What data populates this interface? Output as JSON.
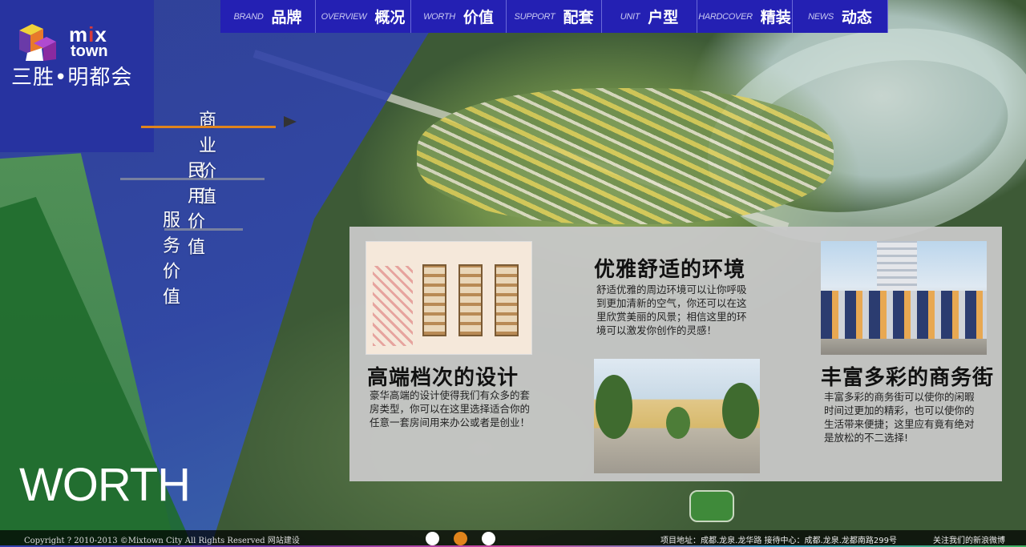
{
  "logo": {
    "brand_mix_left": "m",
    "brand_mix_i": "i",
    "brand_mix_right": "x",
    "brand_town": "town",
    "brand_cn": "三胜•明都会"
  },
  "colors": {
    "nav_bg": "#2420b3",
    "accent_orange": "#e0841c",
    "panel_bg": "#c8c8c8",
    "logo_block": "#2733a0"
  },
  "nav": [
    {
      "en": "BRAND",
      "zh": "品牌"
    },
    {
      "en": "OVERVIEW",
      "zh": "概况"
    },
    {
      "en": "WORTH",
      "zh": "价值"
    },
    {
      "en": "SUPPORT",
      "zh": "配套"
    },
    {
      "en": "UNIT",
      "zh": "户型"
    },
    {
      "en": "HARDCOVER",
      "zh": "精装"
    },
    {
      "en": "NEWS",
      "zh": "动态"
    }
  ],
  "side_menu": [
    {
      "label": "商业价值",
      "active": true
    },
    {
      "label": "民用价值",
      "active": false
    },
    {
      "label": "服务价值",
      "active": false
    }
  ],
  "section_title": "WORTH",
  "panel": {
    "design": {
      "title": "高端档次的设计",
      "text": "豪华高端的设计使得我们有众多的套房类型，你可以在这里选择适合你的任意一套房间用来办公或者是创业！",
      "image": "floor-plan-image"
    },
    "environment": {
      "title": "优雅舒适的环境",
      "text": "舒适优雅的周边环境可以让你呼吸到更加清新的空气，你还可以在这里欣赏美丽的风景；相信这里的环境可以激发你创作的灵感！",
      "image": "plaza-image"
    },
    "street": {
      "title": "丰富多彩的商务街",
      "text": "丰富多彩的商务街可以使你的闲暇时间过更加的精彩，也可以使你的生活带来便捷；这里应有竟有绝对是放松的不二选择!",
      "image": "shopping-street-image"
    }
  },
  "slider": {
    "count": 3,
    "active_index": 1
  },
  "footer": {
    "copyright": "Copyright ? 2010-2013 ©Mixtown City All Rights Reserved 网站建设",
    "address": "项目地址：成都.龙泉.龙华路  接待中心：成都.龙泉.龙都南路299号",
    "follow": "关注我们的新浪微博"
  }
}
